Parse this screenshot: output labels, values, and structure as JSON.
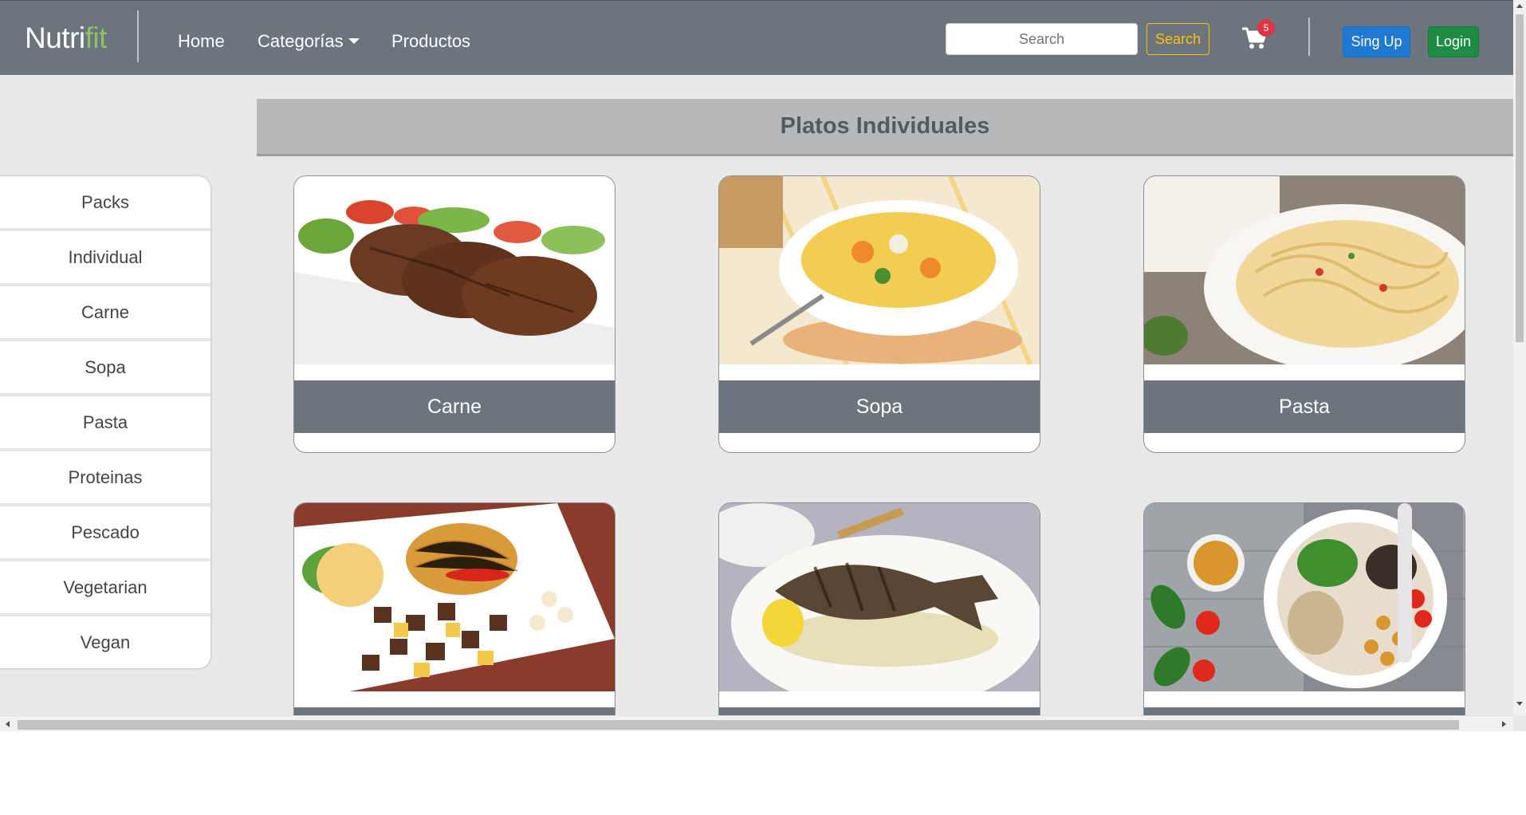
{
  "navbar": {
    "brand_main": "Nutri",
    "brand_accent": "fit",
    "links": [
      "Home",
      "Categorías",
      "Productos"
    ],
    "search_placeholder": "Search",
    "search_button": "Search",
    "cart_icon": "cart-icon",
    "cart_count": "5",
    "signup_label": "Sing Up",
    "login_label": "Login"
  },
  "sidebar": {
    "items": [
      "Packs",
      "Individual",
      "Carne",
      "Sopa",
      "Pasta",
      "Proteinas",
      "Pescado",
      "Vegetarian",
      "Vegan"
    ]
  },
  "section": {
    "title": "Platos Individuales"
  },
  "cards": [
    {
      "label": "Carne"
    },
    {
      "label": "Sopa"
    },
    {
      "label": "Pasta"
    },
    {
      "label": ""
    },
    {
      "label": ""
    },
    {
      "label": ""
    }
  ],
  "colors": {
    "navbar_bg": "#6c757d",
    "brand_accent": "#8cc06a",
    "search_button": "#ffc107",
    "signup": "#1f78d1",
    "login": "#1e8c42",
    "badge": "#dc3545"
  }
}
